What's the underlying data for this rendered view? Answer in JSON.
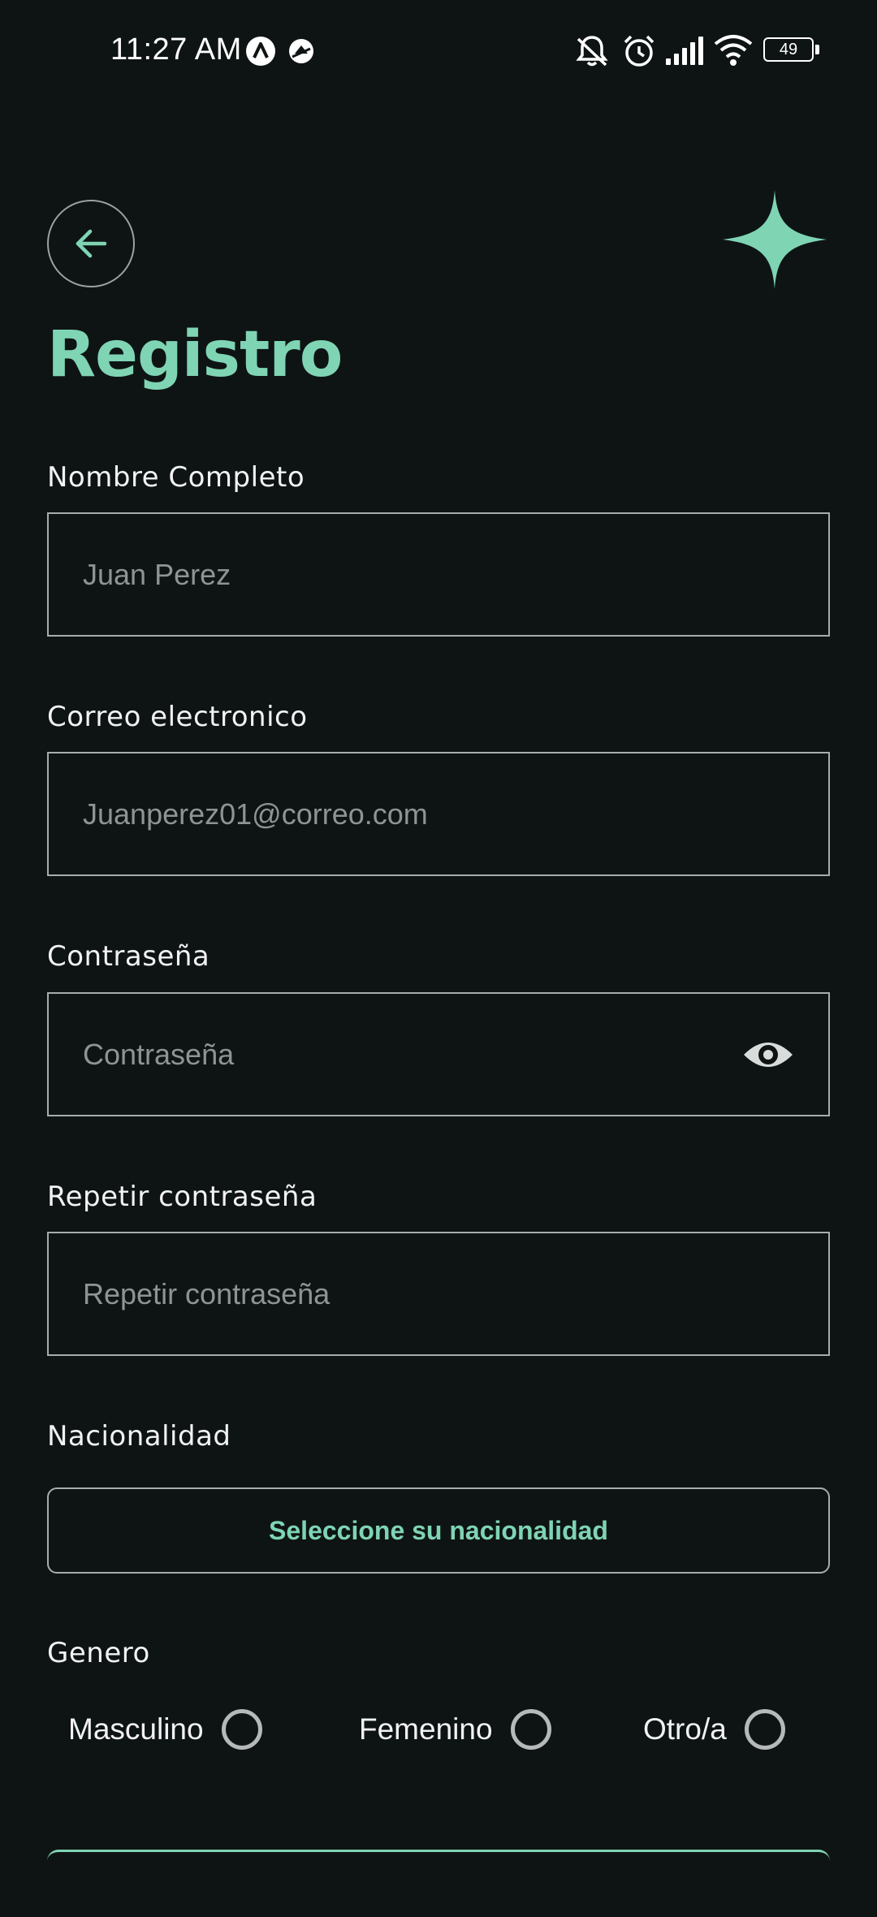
{
  "status_bar": {
    "time": "11:27 AM",
    "battery": "49",
    "icons": [
      "app-a-icon",
      "app-b-icon",
      "mute-icon",
      "alarm-icon",
      "signal-icon",
      "wifi-icon",
      "battery-icon"
    ]
  },
  "header": {
    "back_icon": "arrow-left-icon",
    "logo_icon": "four-point-star-icon",
    "title": "Registro"
  },
  "form": {
    "full_name": {
      "label": "Nombre Completo",
      "placeholder": "Juan Perez"
    },
    "email": {
      "label": "Correo electronico",
      "placeholder": "Juanperez01@correo.com"
    },
    "password": {
      "label": "Contraseña",
      "placeholder": "Contraseña",
      "toggle_icon": "eye-icon"
    },
    "repeat_password": {
      "label": "Repetir contraseña",
      "placeholder": "Repetir contraseña"
    },
    "nationality": {
      "label": "Nacionalidad",
      "button_label": "Seleccione su nacionalidad"
    },
    "gender": {
      "label": "Genero",
      "options": [
        {
          "label": "Masculino"
        },
        {
          "label": "Femenino"
        },
        {
          "label": "Otro/a"
        }
      ]
    }
  },
  "colors": {
    "background": "#0e1414",
    "accent": "#7fd4b4",
    "border": "#a7adab",
    "placeholder": "#8e9492"
  }
}
